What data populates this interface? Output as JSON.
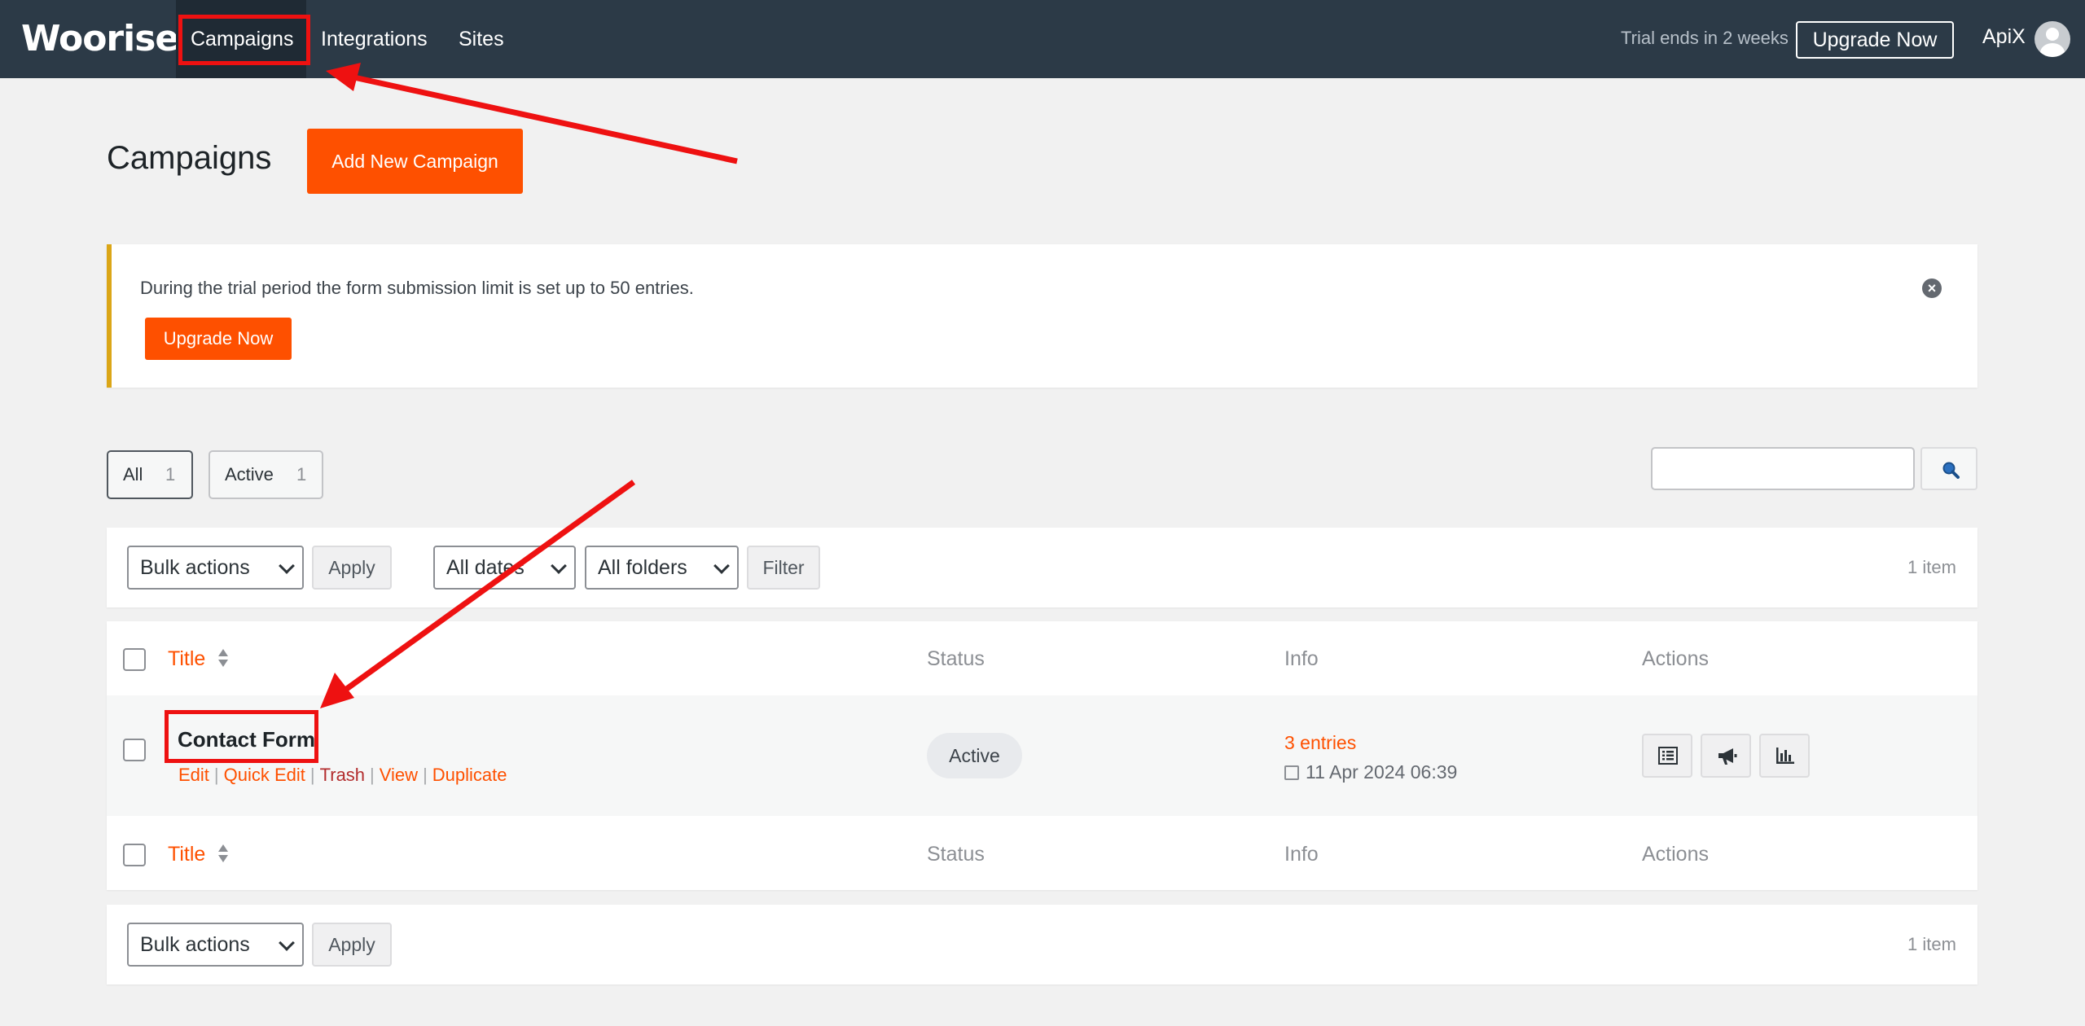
{
  "topbar": {
    "logo": "Woorise",
    "nav": [
      {
        "label": "Campaigns"
      },
      {
        "label": "Integrations"
      },
      {
        "label": "Sites"
      }
    ],
    "trial_text": "Trial ends in 2 weeks",
    "upgrade_label": "Upgrade Now",
    "user_name": "ApiX"
  },
  "page": {
    "title": "Campaigns",
    "add_new_label": "Add New Campaign"
  },
  "notice": {
    "text": "During the trial period the form submission limit is set up to 50 entries.",
    "upgrade_label": "Upgrade Now",
    "close_glyph": "×"
  },
  "views": [
    {
      "label": "All",
      "count": "1"
    },
    {
      "label": "Active",
      "count": "1"
    }
  ],
  "search": {
    "placeholder": ""
  },
  "tablenav_top": {
    "bulk_actions": "Bulk actions",
    "apply": "Apply",
    "dates": "All dates",
    "folders": "All folders",
    "filter": "Filter",
    "count": "1 item"
  },
  "table": {
    "columns": {
      "title": "Title",
      "status": "Status",
      "info": "Info",
      "actions": "Actions"
    },
    "rows": [
      {
        "title": "Contact Form",
        "actions": {
          "edit": "Edit",
          "quick_edit": "Quick Edit",
          "trash": "Trash",
          "view": "View",
          "duplicate": "Duplicate"
        },
        "status": "Active",
        "entries": "3 entries",
        "date": "11 Apr 2024 06:39",
        "action_icons": [
          "entries-list-icon",
          "megaphone-icon",
          "bar-chart-icon"
        ]
      }
    ]
  },
  "tablenav_bottom": {
    "bulk_actions": "Bulk actions",
    "apply": "Apply",
    "count": "1 item"
  },
  "colors": {
    "accent": "#fe5000",
    "topbar": "#2c3a47",
    "annotation": "#ee1111"
  }
}
